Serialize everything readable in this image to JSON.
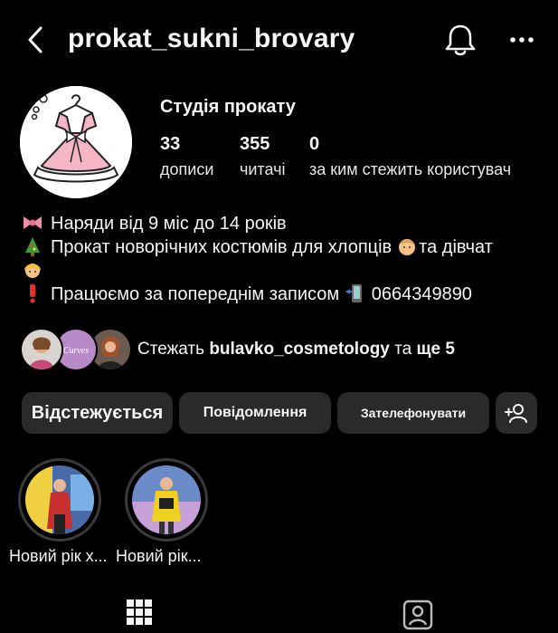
{
  "header": {
    "username": "prokat_sukni_brovary"
  },
  "profile": {
    "account_name": "Студія прокату",
    "stats": [
      {
        "value": "33",
        "label": "дописи"
      },
      {
        "value": "355",
        "label": "читачі"
      },
      {
        "value": "0",
        "label": "за ким стежить користувач"
      }
    ]
  },
  "bio": {
    "line1": "Наряди від 9 міс до 14 років",
    "line2a": "Прокат новорічних костюмів для хлопців",
    "line2b": "та дівчат",
    "line3": "Працюємо за попереднім записом",
    "phone": "0664349890"
  },
  "followed_by": {
    "prefix": "Стежать",
    "account": "bulavko_cosmetology",
    "middle": "та",
    "more": "ще 5",
    "avatar2_text": "Curves"
  },
  "actions": {
    "following": "Відстежується",
    "message": "Повідомлення",
    "call": "Зателефонувати"
  },
  "highlights": [
    {
      "label": "Новий рік х..."
    },
    {
      "label": "Новий рік..."
    }
  ],
  "icons": {
    "back": "chevron-left-icon",
    "bell": "bell-icon",
    "more": "more-horizontal-icon",
    "add_person": "add-person-icon",
    "grid": "grid-icon",
    "tagged": "tagged-person-icon"
  },
  "colors": {
    "background": "#000000",
    "button": "#2a2a2c",
    "text": "#f5f5f5",
    "dress_pink": "#f4b6c6"
  }
}
